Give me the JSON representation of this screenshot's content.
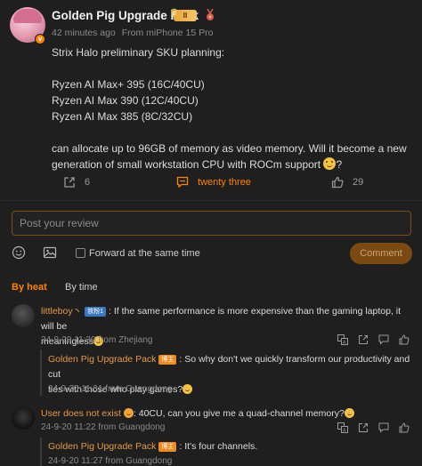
{
  "post": {
    "author": "Golden Pig Upgrade Pack",
    "vip_level": "II",
    "time": "42 minutes ago",
    "source": "From miPhone 15 Pro",
    "lines": [
      "Strix Halo preliminary SKU planning:",
      "",
      "Ryzen AI Max+ 395 (16C/40CU)",
      "Ryzen AI Max 390 (12C/40CU)",
      "Ryzen AI Max 385 (8C/32CU)",
      "",
      "can allocate up to 96GB of memory as video memory. Will it become a new",
      "generation of small workstation CPU with ROCm support"
    ],
    "repost_count": "6",
    "comment_count": "twenty three",
    "like_count": "29"
  },
  "composer": {
    "placeholder": "Post your review",
    "forward_label": "Forward at the same time",
    "submit_label": "Comment"
  },
  "sort_tabs": [
    "By heat",
    "By time"
  ],
  "comments": [
    {
      "name": "littleboy丶",
      "tag": "铁粉1",
      "text_line1": ": If the same performance is more expensive than the gaming laptop, it will be",
      "text_line2": "meaningless",
      "meta": "24-9-20 11:30 from Zhejiang"
    },
    {
      "name": "Golden Pig Upgrade Pack",
      "tag": "博主",
      "text_line1": ": So why don't we quickly transform our productivity and cut",
      "text_line2": "ties with those who play games?",
      "meta": "24-9-20 11:31 from Guangdong"
    },
    {
      "name": "User does not exist",
      "text_line1": ": 40CU, can you give me a quad-channel memory?",
      "meta": "24-9-20 11:22 from Guangdong"
    },
    {
      "name": "Golden Pig Upgrade Pack",
      "tag": "博主",
      "text_line1": ": It's four channels.",
      "meta": "24-9-20 11:27 from Guangdong"
    }
  ],
  "colors": {
    "accent": "#ff8200",
    "name": "#e59a42",
    "background": "#1f1f1f"
  }
}
